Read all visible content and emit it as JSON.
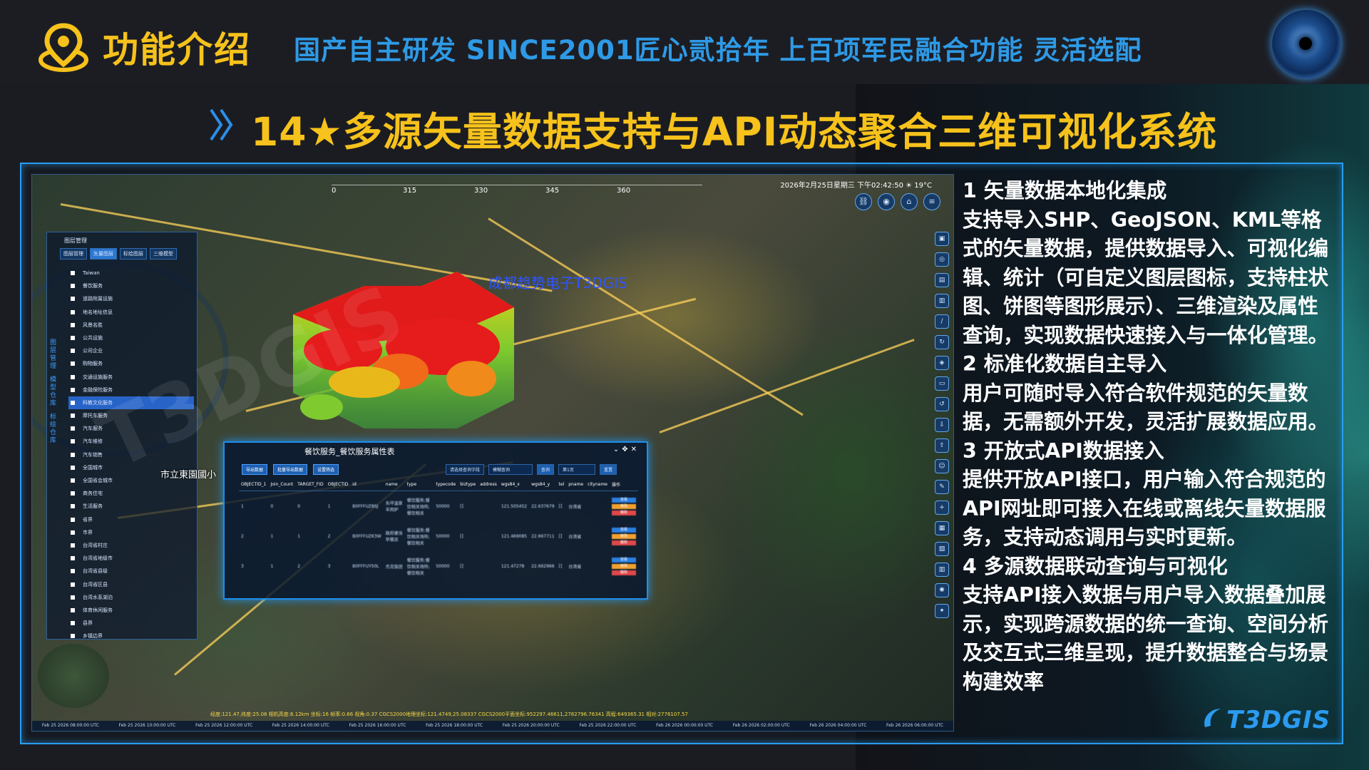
{
  "header": {
    "title": "功能介绍",
    "slogan": "国产自主研发 SINCE2001匠心贰拾年 上百项军民融合功能 灵活选配"
  },
  "section": {
    "title": "14★多源矢量数据支持与API动态聚合三维可视化系统"
  },
  "map": {
    "datetime": "2026年2月25日星期三 下午02:42:50",
    "temperature": "19°C",
    "compass": [
      "0",
      "315",
      "330",
      "345",
      "360"
    ],
    "watermark": "成都趋势电子T3DGIS",
    "overlay_watermark": "T3DGIS",
    "labels": [
      "市立東園國小"
    ],
    "left_panel": {
      "title": "图层管理",
      "tabs": [
        "图层管理",
        "矢量图层",
        "标绘图层",
        "三维模型"
      ],
      "root": "Taiwan",
      "items": [
        "餐饮服务",
        "道路附属设施",
        "地名地址信息",
        "风景名胜",
        "公共设施",
        "公司企业",
        "购物服务",
        "交通设施服务",
        "金融保险服务",
        "科教文化服务",
        "摩托车服务",
        "汽车服务",
        "汽车维修",
        "汽车销售",
        "全国城市",
        "全国省会城市",
        "商务住宅",
        "生活服务",
        "省界",
        "市界",
        "台湾省村庄",
        "台湾省地级市",
        "台湾省县级",
        "台湾省区县",
        "台湾水系湖泊",
        "体育休闲服务",
        "县界",
        "乡镇边界"
      ],
      "selected_index": 9,
      "side_tabs": [
        "图层管理",
        "模型仓库",
        "标绘仓库"
      ]
    },
    "attribute_window": {
      "title": "餐饮服务_餐饮服务属性表",
      "toolbar": [
        "导出数据",
        "批量导出数据",
        "设置筛选"
      ],
      "search_hint": "请选择查询字段",
      "search_placeholder": "模糊查询",
      "search_button": "查询",
      "reset_button": "重置",
      "page": "第1页",
      "columns": [
        "OBJECTID_1",
        "Join_Count",
        "TARGET_FID",
        "OBJECTID",
        "id",
        "name",
        "type",
        "typecode",
        "biztype",
        "address",
        "wgs84_x",
        "wgs84_y",
        "tel",
        "pname",
        "cityname",
        "操作"
      ],
      "rows": [
        [
          "1",
          "0",
          "0",
          "1",
          "B0FFFUZ8SJ",
          "东坪温泉羊肉炉",
          "餐饮服务;餐饮相关场所;餐饮相关",
          "50000",
          "[]",
          "",
          "121.505452",
          "22.637679",
          "[]",
          "台湾省",
          "",
          ""
        ],
        [
          "2",
          "1",
          "1",
          "2",
          "B0FFFUZK3W",
          "政府便当早餐店",
          "餐饮服务;餐饮相关场所;餐饮相关",
          "50000",
          "[]",
          "",
          "121.469085",
          "22.667711",
          "[]",
          "台湾省",
          "",
          ""
        ],
        [
          "3",
          "1",
          "2",
          "3",
          "B0FFFUY50L",
          "杰克饭团",
          "餐饮服务;餐饮相关场所;餐饮相关",
          "50000",
          "[]",
          "",
          "121.47278",
          "22.662966",
          "[]",
          "台湾省",
          "",
          ""
        ]
      ],
      "actions": [
        "查看",
        "修改",
        "删除"
      ]
    },
    "status": "经度:121.47,纬度:25.08 相机高度:6.12km 坐标:16 帧率:0.66 视角:0.37 CGCS2000地理坐标:121.4749,25.08337 CGCS2000平面坐标:952297.46611,2782796.76341 高程:649365.31 相对:2776107.57",
    "timeline": [
      "Feb 25 2026 08:00:00 UTC",
      "Feb 25 2026 10:00:00 UTC",
      "Feb 25 2026 12:00:00 UTC",
      "Feb 25 2026 14:00:00 UTC",
      "Feb 25 2026 16:00:00 UTC",
      "Feb 25 2026 18:00:00 UTC",
      "Feb 25 2026 20:00:00 UTC",
      "Feb 25 2026 22:00:00 UTC",
      "Feb 26 2026 00:00:00 UTC",
      "Feb 26 2026 02:00:00 UTC",
      "Feb 26 2026 04:00:00 UTC",
      "Feb 26 2026 06:00:00 UTC"
    ]
  },
  "description": [
    {
      "heading": "1 矢量数据本地化集成",
      "body": "支持导入SHP、GeoJSON、KML等格式的矢量数据，提供数据导入、可视化编辑、统计（可自定义图层图标，支持柱状图、饼图等图形展示）、三维渲染及属性查询，实现数据快速接入与一体化管理。"
    },
    {
      "heading": "2 标准化数据自主导入",
      "body": "用户可随时导入符合软件规范的矢量数据，无需额外开发，灵活扩展数据应用。"
    },
    {
      "heading": "3 开放式API数据接入",
      "body": "提供开放API接口，用户输入符合规范的API网址即可接入在线或离线矢量数据服务，支持动态调用与实时更新。"
    },
    {
      "heading": "4 多源数据联动查询与可视化",
      "body": "支持API接入数据与用户导入数据叠加展示，实现跨源数据的统一查询、空间分析及交互式三维呈现，提升数据整合与场景构建效率"
    }
  ],
  "logo": "T3DGIS",
  "colors": {
    "accent_yellow": "#f6c21b",
    "slogan_blue": "#2e9ae6",
    "frame_blue": "#2a9cf0"
  }
}
